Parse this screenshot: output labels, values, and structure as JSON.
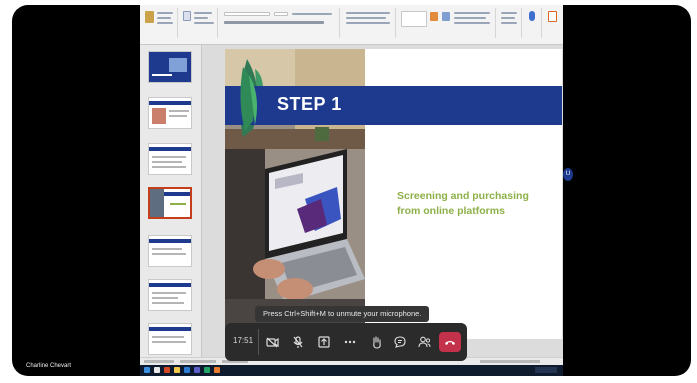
{
  "meeting": {
    "participant_name": "Charline Chevart",
    "timer": "17:51",
    "mic_hint": "Press Ctrl+Shift+M to unmute your microphone."
  },
  "slide": {
    "title": "STEP 1",
    "subtitle": "Screening and purchasing from online platforms",
    "accent_color": "#1d3a8f",
    "subtitle_color": "#8db048"
  },
  "controls": {
    "buttons": [
      "camera-off",
      "mic-off",
      "share",
      "more",
      "raise-hand",
      "chat",
      "participants",
      "hang-up"
    ]
  },
  "icons": [
    "camera-off-icon",
    "mic-off-icon",
    "share-icon",
    "more-icon",
    "raise-hand-icon",
    "chat-icon",
    "participants-icon",
    "hang-up-icon"
  ]
}
